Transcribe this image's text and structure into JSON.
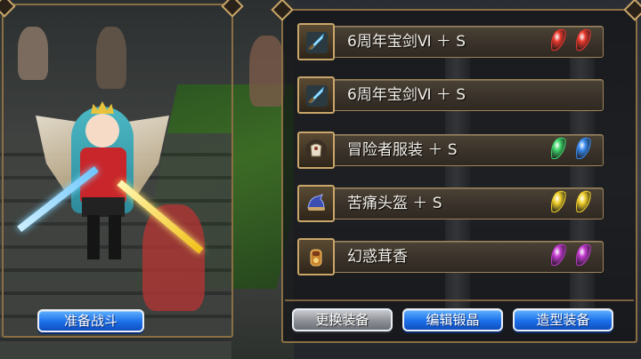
{
  "left": {
    "prepare_button": "准备战斗"
  },
  "equipment": [
    {
      "name": "6周年宝剑Ⅵ ＋ S",
      "icon": "sword-icon",
      "gems": [
        "red",
        "red"
      ]
    },
    {
      "name": "6周年宝剑Ⅵ ＋ S",
      "icon": "sword-icon",
      "gems": []
    },
    {
      "name": "冒险者服装 ＋ S",
      "icon": "armor-icon",
      "gems": [
        "green",
        "blue"
      ]
    },
    {
      "name": "苦痛头盔 ＋ S",
      "icon": "helmet-icon",
      "gems": [
        "yellow",
        "yellow"
      ]
    },
    {
      "name": "幻惑茸香",
      "icon": "accessory-icon",
      "gems": [
        "purple",
        "purple"
      ]
    }
  ],
  "buttons": {
    "change": "更换装备",
    "edit_crystal": "编辑锻晶",
    "style": "造型装备"
  },
  "colors": {
    "frame": "#8a6f44",
    "button_blue": "#1c6fe8",
    "gem_red": "#e8382c",
    "gem_green": "#3fd46a",
    "gem_blue": "#3a8cf0",
    "gem_yellow": "#f0d02a",
    "gem_purple": "#c23ad0"
  }
}
